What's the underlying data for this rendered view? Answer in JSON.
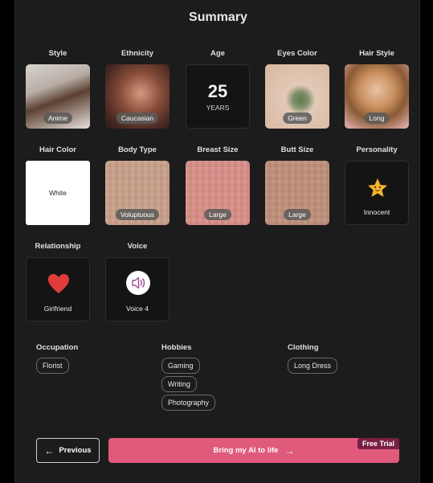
{
  "title": "Summary",
  "row1": [
    {
      "label": "Style",
      "badge": "Anime"
    },
    {
      "label": "Ethnicity",
      "badge": "Caucasian"
    },
    {
      "label": "Age",
      "value": "25",
      "unit": "YEARS"
    },
    {
      "label": "Eyes Color",
      "badge": "Green"
    },
    {
      "label": "Hair Style",
      "badge": "Long"
    }
  ],
  "row2": [
    {
      "label": "Hair Color",
      "value": "White"
    },
    {
      "label": "Body Type",
      "badge": "Voluptuous"
    },
    {
      "label": "Breast Size",
      "badge": "Large"
    },
    {
      "label": "Butt Size",
      "badge": "Large"
    },
    {
      "label": "Personality",
      "value": "Innocent",
      "icon": "star-icon"
    }
  ],
  "row3": [
    {
      "label": "Relationship",
      "value": "Girlfriend",
      "icon": "heart-icon"
    },
    {
      "label": "Voice",
      "value": "Voice 4",
      "icon": "speaker-icon"
    }
  ],
  "occupation": {
    "label": "Occupation",
    "items": [
      "Florist"
    ]
  },
  "hobbies": {
    "label": "Hobbies",
    "items": [
      "Gaming",
      "Writing",
      "Photography"
    ]
  },
  "clothing": {
    "label": "Clothing",
    "items": [
      "Long Dress"
    ]
  },
  "buttons": {
    "previous": "Previous",
    "go": "Bring my AI to life",
    "free_trial": "Free Trial"
  },
  "colors": {
    "accent": "#e05a7c",
    "badge": "#7a1f44",
    "panel": "#1c1c1c"
  }
}
